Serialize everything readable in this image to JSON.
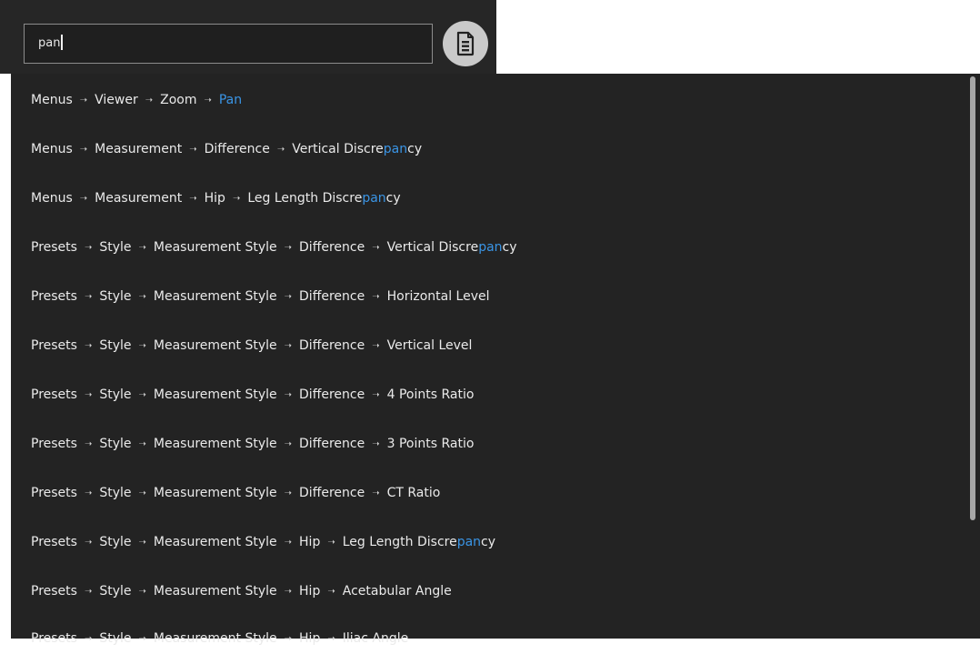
{
  "search": {
    "value": "pan"
  },
  "icons": {
    "document": "document-icon"
  },
  "colors": {
    "background": "#232323",
    "text": "#eaeaea",
    "highlight": "#3a95e6"
  },
  "results": [
    {
      "path": [
        "Menus",
        "Viewer",
        "Zoom"
      ],
      "last_prefix": "",
      "last_match": "Pan",
      "last_suffix": ""
    },
    {
      "path": [
        "Menus",
        "Measurement",
        "Difference"
      ],
      "last_prefix": "Vertical Discre",
      "last_match": "pan",
      "last_suffix": "cy"
    },
    {
      "path": [
        "Menus",
        "Measurement",
        "Hip"
      ],
      "last_prefix": "Leg Length Discre",
      "last_match": "pan",
      "last_suffix": "cy"
    },
    {
      "path": [
        "Presets",
        "Style",
        "Measurement Style",
        "Difference"
      ],
      "last_prefix": "Vertical Discre",
      "last_match": "pan",
      "last_suffix": "cy"
    },
    {
      "path": [
        "Presets",
        "Style",
        "Measurement Style",
        "Difference"
      ],
      "last_prefix": "Horizontal Level",
      "last_match": "",
      "last_suffix": ""
    },
    {
      "path": [
        "Presets",
        "Style",
        "Measurement Style",
        "Difference"
      ],
      "last_prefix": "Vertical Level",
      "last_match": "",
      "last_suffix": ""
    },
    {
      "path": [
        "Presets",
        "Style",
        "Measurement Style",
        "Difference"
      ],
      "last_prefix": "4 Points Ratio",
      "last_match": "",
      "last_suffix": ""
    },
    {
      "path": [
        "Presets",
        "Style",
        "Measurement Style",
        "Difference"
      ],
      "last_prefix": "3 Points Ratio",
      "last_match": "",
      "last_suffix": ""
    },
    {
      "path": [
        "Presets",
        "Style",
        "Measurement Style",
        "Difference"
      ],
      "last_prefix": "CT Ratio",
      "last_match": "",
      "last_suffix": ""
    },
    {
      "path": [
        "Presets",
        "Style",
        "Measurement Style",
        "Hip"
      ],
      "last_prefix": "Leg Length Discre",
      "last_match": "pan",
      "last_suffix": "cy"
    },
    {
      "path": [
        "Presets",
        "Style",
        "Measurement Style",
        "Hip"
      ],
      "last_prefix": "Acetabular Angle",
      "last_match": "",
      "last_suffix": ""
    },
    {
      "path": [
        "Presets",
        "Style",
        "Measurement Style",
        "Hip"
      ],
      "last_prefix": "Iliac Angle",
      "last_match": "",
      "last_suffix": ""
    }
  ]
}
